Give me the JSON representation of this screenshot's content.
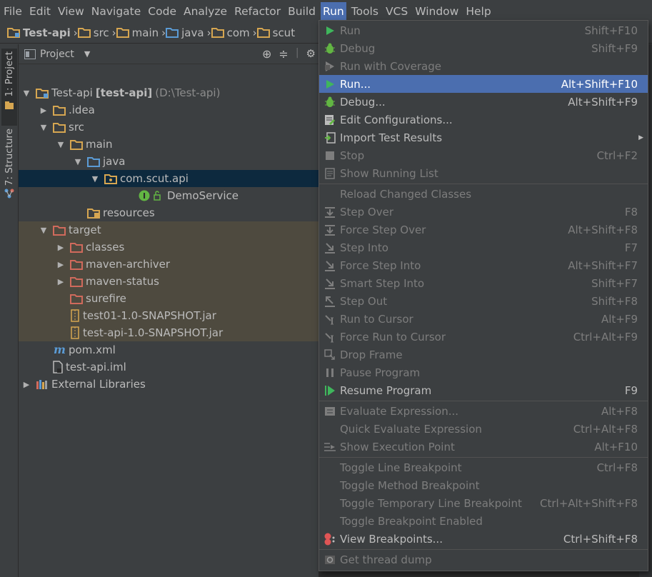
{
  "menubar": {
    "items": [
      {
        "label": "File",
        "active": false
      },
      {
        "label": "Edit",
        "active": false
      },
      {
        "label": "View",
        "active": false
      },
      {
        "label": "Navigate",
        "active": false
      },
      {
        "label": "Code",
        "active": false
      },
      {
        "label": "Analyze",
        "active": false
      },
      {
        "label": "Refactor",
        "active": false
      },
      {
        "label": "Build",
        "active": false
      },
      {
        "label": "Run",
        "active": true
      },
      {
        "label": "Tools",
        "active": false
      },
      {
        "label": "VCS",
        "active": false
      },
      {
        "label": "Window",
        "active": false
      },
      {
        "label": "Help",
        "active": false
      }
    ]
  },
  "breadcrumb": [
    "Test-api",
    "src",
    "main",
    "java",
    "com",
    "scut"
  ],
  "stripe": {
    "project_tab": "1: Project",
    "structure_tab": "7: Structure"
  },
  "panel": {
    "title": "Project"
  },
  "tree": [
    {
      "label": "Test-api",
      "bold": "[test-api]",
      "dim": "(D:\\Test-api)",
      "arrow": "down",
      "indent": 0,
      "icon": "module-folder-icon",
      "state": ""
    },
    {
      "label": ".idea",
      "arrow": "right",
      "indent": 1,
      "icon": "folder-icon",
      "state": ""
    },
    {
      "label": "src",
      "arrow": "down",
      "indent": 1,
      "icon": "folder-icon",
      "state": ""
    },
    {
      "label": "main",
      "arrow": "down",
      "indent": 2,
      "icon": "folder-icon",
      "state": ""
    },
    {
      "label": "java",
      "arrow": "down",
      "indent": 3,
      "icon": "source-folder-icon",
      "state": ""
    },
    {
      "label": "com.scut.api",
      "arrow": "down",
      "indent": 4,
      "icon": "package-icon",
      "state": "sel"
    },
    {
      "label": "DemoService",
      "arrow": "",
      "indent": 6,
      "icon": "interface-icon",
      "state": "sel2"
    },
    {
      "label": "resources",
      "arrow": "",
      "indent": 3,
      "icon": "resources-folder-icon",
      "state": ""
    },
    {
      "label": "target",
      "arrow": "down",
      "indent": 1,
      "icon": "excluded-folder-icon",
      "state": "excl"
    },
    {
      "label": "classes",
      "arrow": "right",
      "indent": 2,
      "icon": "excluded-folder-icon",
      "state": "excl"
    },
    {
      "label": "maven-archiver",
      "arrow": "right",
      "indent": 2,
      "icon": "excluded-folder-icon",
      "state": "excl"
    },
    {
      "label": "maven-status",
      "arrow": "right",
      "indent": 2,
      "icon": "excluded-folder-icon",
      "state": "excl"
    },
    {
      "label": "surefire",
      "arrow": "",
      "indent": 2,
      "icon": "excluded-folder-icon",
      "state": "excl"
    },
    {
      "label": "test01-1.0-SNAPSHOT.jar",
      "arrow": "",
      "indent": 2,
      "icon": "jar-icon",
      "state": "excl"
    },
    {
      "label": "test-api-1.0-SNAPSHOT.jar",
      "arrow": "",
      "indent": 2,
      "icon": "jar-icon",
      "state": "excl"
    },
    {
      "label": "pom.xml",
      "arrow": "",
      "indent": 1,
      "icon": "maven-icon",
      "state": ""
    },
    {
      "label": "test-api.iml",
      "arrow": "",
      "indent": 1,
      "icon": "iml-file-icon",
      "state": ""
    },
    {
      "label": "External Libraries",
      "arrow": "right",
      "indent": 0,
      "icon": "libraries-icon",
      "state": ""
    }
  ],
  "run_menu": [
    {
      "label": "Run",
      "shortcut": "Shift+F10",
      "icon": "run-icon",
      "state": "disabled",
      "sub": false
    },
    {
      "label": "Debug",
      "shortcut": "Shift+F9",
      "icon": "debug-icon",
      "state": "disabled",
      "sub": false
    },
    {
      "label": "Run with Coverage",
      "shortcut": "",
      "icon": "coverage-icon",
      "state": "disabled",
      "sub": false
    },
    {
      "label": "Run...",
      "shortcut": "Alt+Shift+F10",
      "icon": "run-icon",
      "state": "hl",
      "sub": false
    },
    {
      "label": "Debug...",
      "shortcut": "Alt+Shift+F9",
      "icon": "debug-icon",
      "state": "",
      "sub": false
    },
    {
      "label": "Edit Configurations...",
      "shortcut": "",
      "icon": "edit-config-icon",
      "state": "",
      "sub": false
    },
    {
      "label": "Import Test Results",
      "shortcut": "",
      "icon": "import-icon",
      "state": "",
      "sub": true
    },
    {
      "label": "Stop",
      "shortcut": "Ctrl+F2",
      "icon": "stop-icon",
      "state": "disabled",
      "sub": false
    },
    {
      "label": "Show Running List",
      "shortcut": "",
      "icon": "list-icon",
      "state": "disabled",
      "sub": false,
      "sep_after": true
    },
    {
      "label": "Reload Changed Classes",
      "shortcut": "",
      "icon": "",
      "state": "disabled",
      "sub": false
    },
    {
      "label": "Step Over",
      "shortcut": "F8",
      "icon": "step-over-icon",
      "state": "disabled",
      "sub": false
    },
    {
      "label": "Force Step Over",
      "shortcut": "Alt+Shift+F8",
      "icon": "force-step-over-icon",
      "state": "disabled",
      "sub": false
    },
    {
      "label": "Step Into",
      "shortcut": "F7",
      "icon": "step-into-icon",
      "state": "disabled",
      "sub": false
    },
    {
      "label": "Force Step Into",
      "shortcut": "Alt+Shift+F7",
      "icon": "force-step-into-icon",
      "state": "disabled",
      "sub": false
    },
    {
      "label": "Smart Step Into",
      "shortcut": "Shift+F7",
      "icon": "smart-step-into-icon",
      "state": "disabled",
      "sub": false
    },
    {
      "label": "Step Out",
      "shortcut": "Shift+F8",
      "icon": "step-out-icon",
      "state": "disabled",
      "sub": false
    },
    {
      "label": "Run to Cursor",
      "shortcut": "Alt+F9",
      "icon": "run-to-cursor-icon",
      "state": "disabled",
      "sub": false
    },
    {
      "label": "Force Run to Cursor",
      "shortcut": "Ctrl+Alt+F9",
      "icon": "force-run-to-cursor-icon",
      "state": "disabled",
      "sub": false
    },
    {
      "label": "Drop Frame",
      "shortcut": "",
      "icon": "drop-frame-icon",
      "state": "disabled",
      "sub": false
    },
    {
      "label": "Pause Program",
      "shortcut": "",
      "icon": "pause-icon",
      "state": "disabled",
      "sub": false
    },
    {
      "label": "Resume Program",
      "shortcut": "F9",
      "icon": "resume-icon",
      "state": "",
      "sub": false,
      "sep_after": true
    },
    {
      "label": "Evaluate Expression...",
      "shortcut": "Alt+F8",
      "icon": "evaluate-icon",
      "state": "disabled",
      "sub": false
    },
    {
      "label": "Quick Evaluate Expression",
      "shortcut": "Ctrl+Alt+F8",
      "icon": "",
      "state": "disabled",
      "sub": false
    },
    {
      "label": "Show Execution Point",
      "shortcut": "Alt+F10",
      "icon": "execution-point-icon",
      "state": "disabled",
      "sub": false,
      "sep_after": true
    },
    {
      "label": "Toggle Line Breakpoint",
      "shortcut": "Ctrl+F8",
      "icon": "",
      "state": "disabled",
      "sub": false
    },
    {
      "label": "Toggle Method Breakpoint",
      "shortcut": "",
      "icon": "",
      "state": "disabled",
      "sub": false
    },
    {
      "label": "Toggle Temporary Line Breakpoint",
      "shortcut": "Ctrl+Alt+Shift+F8",
      "icon": "",
      "state": "disabled",
      "sub": false
    },
    {
      "label": "Toggle Breakpoint Enabled",
      "shortcut": "",
      "icon": "",
      "state": "disabled",
      "sub": false
    },
    {
      "label": "View Breakpoints...",
      "shortcut": "Ctrl+Shift+F8",
      "icon": "breakpoints-icon",
      "state": "",
      "sub": false,
      "sep_after": true
    },
    {
      "label": "Get thread dump",
      "shortcut": "",
      "icon": "thread-dump-icon",
      "state": "disabled",
      "sub": false
    }
  ],
  "colors": {
    "bg": "#3c3f41",
    "highlight": "#4b6eaf",
    "selection": "#0d293e",
    "excluded": "#4e4a3f",
    "folder": "#d6a651",
    "source_folder": "#5b9bd5",
    "excluded_folder": "#d06a5c",
    "run_green": "#3fb65c"
  }
}
